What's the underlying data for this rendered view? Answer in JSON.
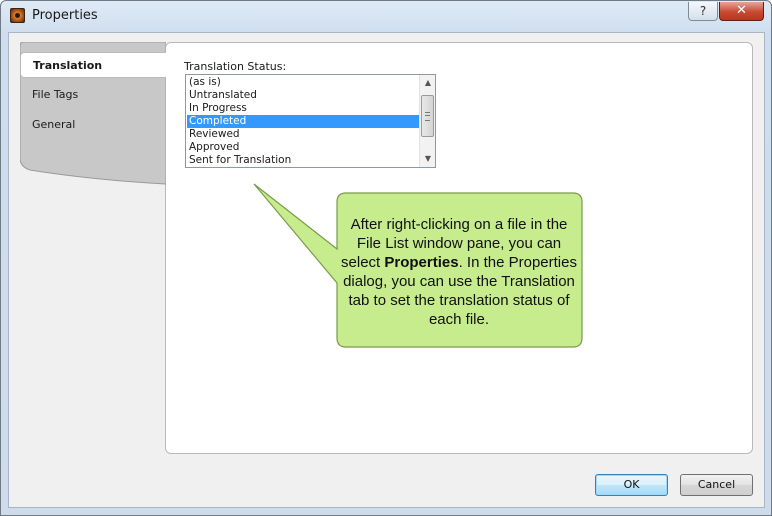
{
  "window": {
    "title": "Properties",
    "help_label": "?",
    "close_label": "✕"
  },
  "tabs": [
    {
      "label": "Translation",
      "active": true
    },
    {
      "label": "File Tags",
      "active": false
    },
    {
      "label": "General",
      "active": false
    }
  ],
  "translation_status": {
    "label": "Translation Status:",
    "options": [
      "(as is)",
      "Untranslated",
      "In Progress",
      "Completed",
      "Reviewed",
      "Approved",
      "Sent for Translation"
    ],
    "selected": "Completed"
  },
  "callout": {
    "text_before": "After right-clicking on a file in the File List window pane, you can select ",
    "bold": "Properties",
    "text_after": ". In the Properties dialog, you can use the Translation tab to set the translation status of each file.",
    "fill_color": "#c6ec8e",
    "border_color": "#7a9a4a"
  },
  "buttons": {
    "ok_label": "OK",
    "cancel_label": "Cancel"
  },
  "icons": {
    "app": "properties-app-icon",
    "scroll_up": "▲",
    "scroll_down": "▼"
  }
}
